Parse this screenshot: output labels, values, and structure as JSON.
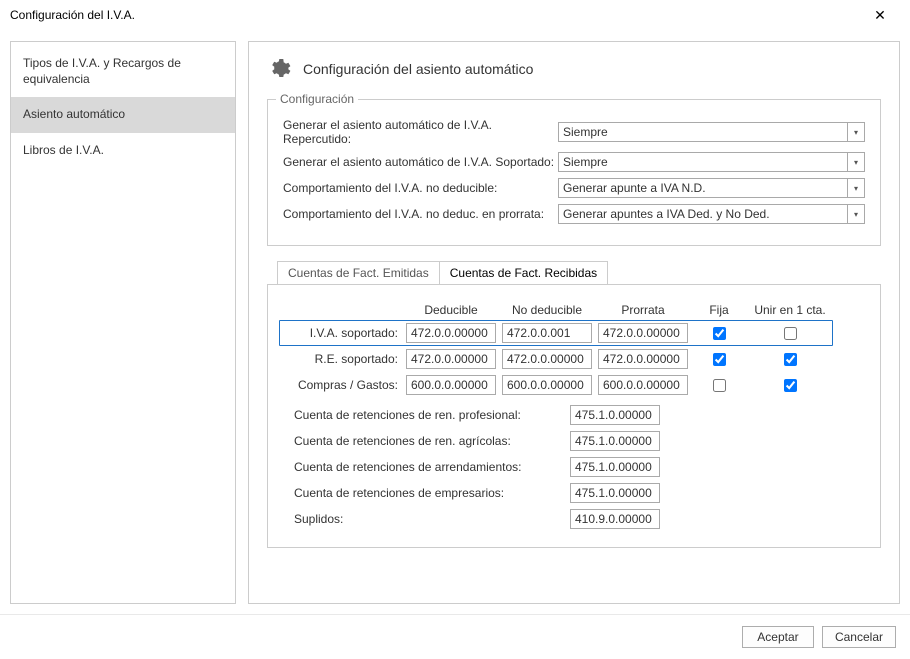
{
  "window": {
    "title": "Configuración del I.V.A."
  },
  "sidebar": {
    "items": [
      {
        "label": "Tipos de I.V.A. y Recargos de equivalencia"
      },
      {
        "label": "Asiento automático"
      },
      {
        "label": "Libros de I.V.A."
      }
    ]
  },
  "header": {
    "title": "Configuración del asiento automático"
  },
  "group": {
    "title": "Configuración"
  },
  "form": {
    "rows": [
      {
        "label": "Generar el asiento automático de I.V.A. Repercutido:",
        "value": "Siempre"
      },
      {
        "label": "Generar el asiento automático de I.V.A. Soportado:",
        "value": "Siempre"
      },
      {
        "label": "Comportamiento del I.V.A. no deducible:",
        "value": "Generar apunte a IVA N.D."
      },
      {
        "label": "Comportamiento del I.V.A. no deduc. en prorrata:",
        "value": "Generar apuntes a IVA Ded. y No Ded."
      }
    ]
  },
  "tabs": {
    "emitidas": "Cuentas de Fact. Emitidas",
    "recibidas": "Cuentas de Fact. Recibidas"
  },
  "cols": {
    "deducible": "Deducible",
    "nodeducible": "No deducible",
    "prorrata": "Prorrata",
    "fija": "Fija",
    "unir": "Unir en 1 cta."
  },
  "rows": {
    "iva": {
      "label": "I.V.A. soportado:",
      "ded": "472.0.0.00000",
      "nod": "472.0.0.001",
      "pro": "472.0.0.00000",
      "fija": true,
      "unir": false
    },
    "re": {
      "label": "R.E. soportado:",
      "ded": "472.0.0.00000",
      "nod": "472.0.0.00000",
      "pro": "472.0.0.00000",
      "fija": true,
      "unir": true
    },
    "compras": {
      "label": "Compras / Gastos:",
      "ded": "600.0.0.00000",
      "nod": "600.0.0.00000",
      "pro": "600.0.0.00000",
      "fija": false,
      "unir": true
    }
  },
  "lower": [
    {
      "label": "Cuenta de retenciones de ren. profesional:",
      "value": "475.1.0.00000"
    },
    {
      "label": "Cuenta de retenciones de ren. agrícolas:",
      "value": "475.1.0.00000"
    },
    {
      "label": "Cuenta de retenciones de arrendamientos:",
      "value": "475.1.0.00000"
    },
    {
      "label": "Cuenta de retenciones de empresarios:",
      "value": "475.1.0.00000"
    },
    {
      "label": "Suplidos:",
      "value": "410.9.0.00000"
    }
  ],
  "buttons": {
    "ok": "Aceptar",
    "cancel": "Cancelar"
  }
}
